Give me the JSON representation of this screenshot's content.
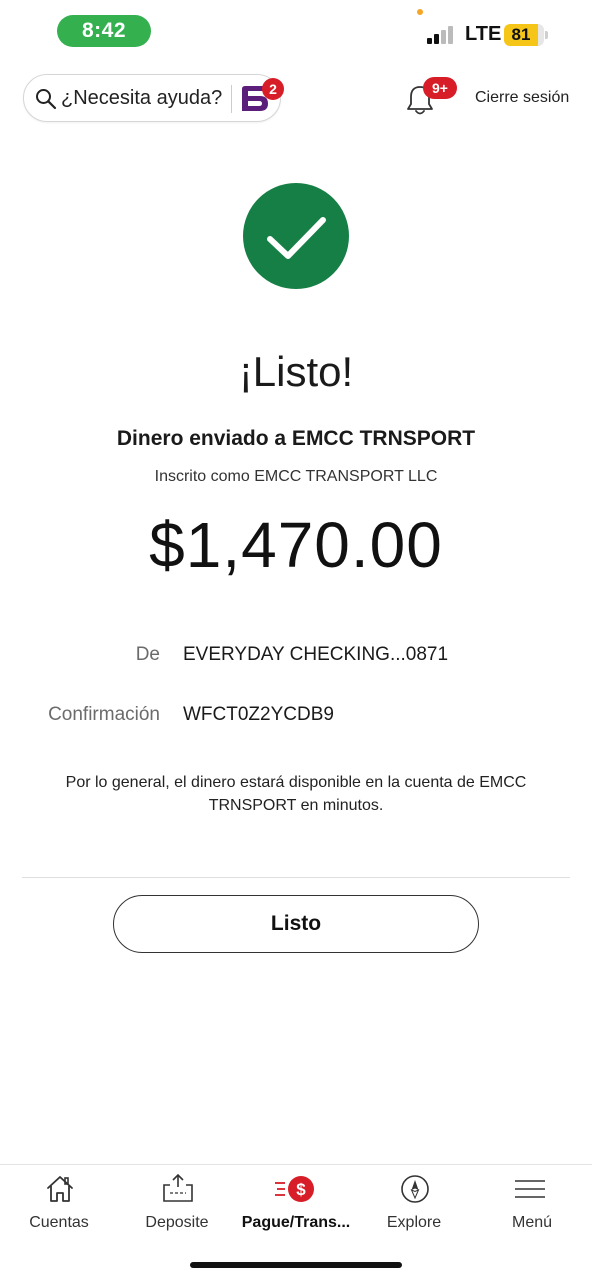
{
  "status_bar": {
    "time": "8:42",
    "network": "LTE",
    "battery": "81"
  },
  "header": {
    "help_placeholder": "¿Necesita ayuda?",
    "assistant_badge": "2",
    "notifications_badge": "9+",
    "signout_label": "Cierre sesión"
  },
  "main": {
    "title": "¡Listo!",
    "sent_to": "Dinero enviado a EMCC TRNSPORT",
    "enrolled_as": "Inscrito como EMCC TRANSPORT LLC",
    "amount": "$1,470.00",
    "details": [
      {
        "label": "De",
        "value": "EVERYDAY CHECKING...0871"
      },
      {
        "label": "Confirmación",
        "value": "WFCT0Z2YCDB9"
      }
    ],
    "note": "Por lo general, el dinero estará disponible en la cuenta de EMCC TRNSPORT en minutos.",
    "done_label": "Listo"
  },
  "bottom_nav": {
    "items": [
      {
        "label": "Cuentas",
        "icon": "home-icon"
      },
      {
        "label": "Deposite",
        "icon": "deposit-icon"
      },
      {
        "label": "Pague/Trans...",
        "icon": "pay-transfer-icon",
        "active": true
      },
      {
        "label": "Explore",
        "icon": "compass-icon"
      },
      {
        "label": "Menú",
        "icon": "menu-icon"
      }
    ]
  },
  "colors": {
    "success_green": "#167f45",
    "brand_red": "#d71e28",
    "time_pill_green": "#34b04f",
    "battery_yellow": "#f5c518",
    "assistant_purple": "#5b1e7a"
  }
}
